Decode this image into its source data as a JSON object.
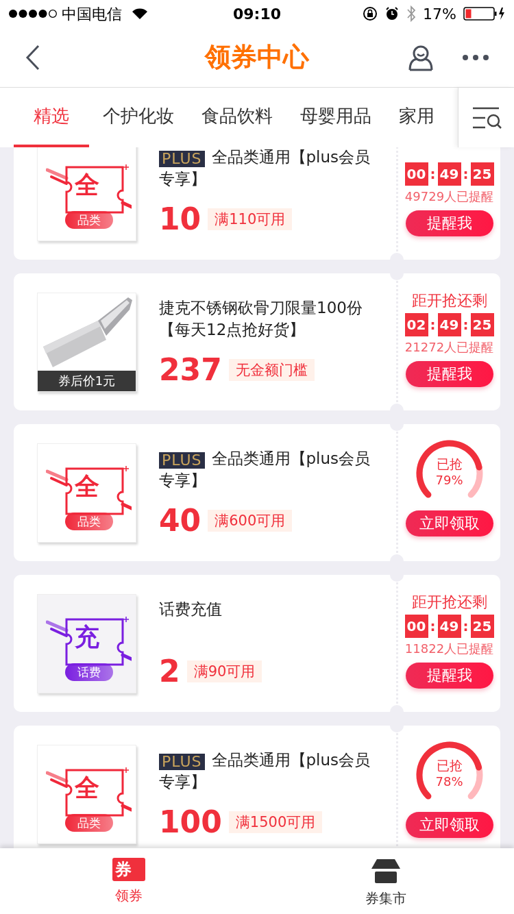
{
  "status_bar": {
    "carrier": "中国电信",
    "time": "09:10",
    "battery": "17%"
  },
  "nav": {
    "title": "领券中心"
  },
  "tabs": [
    {
      "label": "精选",
      "selected": true
    },
    {
      "label": "个护化妆",
      "selected": false
    },
    {
      "label": "食品饮料",
      "selected": false
    },
    {
      "label": "母婴用品",
      "selected": false
    },
    {
      "label": "家用",
      "selected": false
    }
  ],
  "coupons": [
    {
      "kind": "category",
      "icon": {
        "color": "#f0283a",
        "char": "全",
        "label": "品类"
      },
      "plus": "PLUS",
      "title": "全品类通用【plus会员专享】",
      "amount": "10",
      "condition": "满110可用",
      "right": {
        "kind": "countdown",
        "time": [
          "00",
          "49",
          "25"
        ],
        "sep": ":",
        "reminded": "49729人已提醒",
        "button": "提醒我"
      }
    },
    {
      "kind": "product",
      "caption": "券后价1元",
      "title": "捷克不锈钢砍骨刀限量100份【每天12点抢好货】",
      "amount": "237",
      "condition": "无金额门槛",
      "right": {
        "kind": "countdown",
        "label": "距开抢还剩",
        "time": [
          "02",
          "49",
          "25"
        ],
        "sep": ":",
        "reminded": "21272人已提醒",
        "button": "提醒我"
      }
    },
    {
      "kind": "category",
      "icon": {
        "color": "#f0283a",
        "char": "全",
        "label": "品类"
      },
      "plus": "PLUS",
      "title": "全品类通用【plus会员专享】",
      "amount": "40",
      "condition": "满600可用",
      "right": {
        "kind": "progress",
        "label": "已抢",
        "percent": "79%",
        "button": "立即领取"
      }
    },
    {
      "kind": "category",
      "icon": {
        "color": "#7a1fe0",
        "char": "充",
        "label": "话费"
      },
      "title": "话费充值",
      "amount": "2",
      "condition": "满90可用",
      "right": {
        "kind": "countdown",
        "label": "距开抢还剩",
        "time": [
          "00",
          "49",
          "25"
        ],
        "sep": ":",
        "reminded": "11822人已提醒",
        "button": "提醒我"
      }
    },
    {
      "kind": "category",
      "icon": {
        "color": "#f0283a",
        "char": "全",
        "label": "品类"
      },
      "plus": "PLUS",
      "title": "全品类通用【plus会员专享】",
      "amount": "100",
      "condition": "满1500可用",
      "right": {
        "kind": "progress",
        "label": "已抢",
        "percent": "78%",
        "button": "立即领取"
      }
    }
  ],
  "bottom_nav": [
    {
      "label": "领券",
      "icon_char": "券",
      "selected": true
    },
    {
      "label": "券集市",
      "selected": false
    }
  ]
}
